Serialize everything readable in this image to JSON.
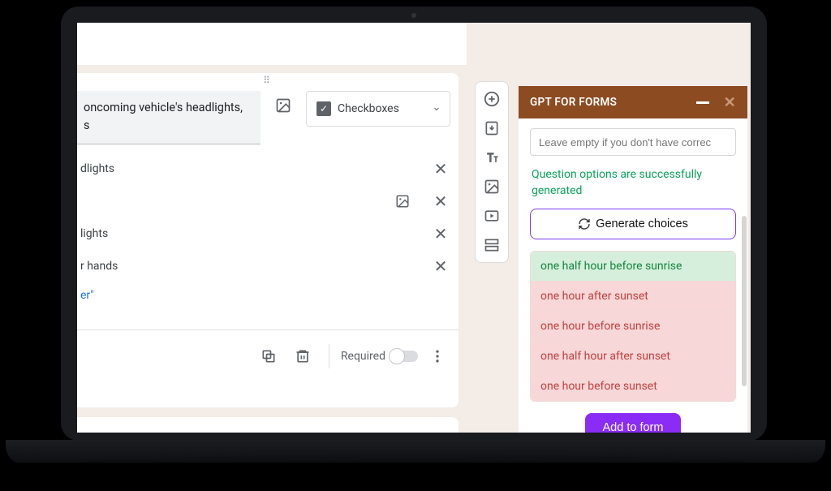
{
  "form": {
    "question_text": "oncoming vehicle's headlights,\ns",
    "image_icon": "image-icon",
    "type_label": "Checkboxes",
    "options": [
      {
        "label": "dlights"
      },
      {
        "label": ""
      },
      {
        "label": "lights"
      },
      {
        "label": "r hands"
      }
    ],
    "add_other": "er\"",
    "duplicate_label": "Duplicate",
    "delete_label": "Delete",
    "required_label": "Required"
  },
  "next_card_text": "",
  "rail": {
    "items": [
      "add-circle",
      "import",
      "text-title",
      "image",
      "video",
      "section"
    ]
  },
  "panel": {
    "title": "GPT FOR FORMS",
    "input_placeholder": "Leave empty if you don't have correc",
    "status": "Question options are successfully generated",
    "generate_label": "Generate choices",
    "choices": [
      {
        "text": "one half hour before sunrise",
        "state": "good"
      },
      {
        "text": "one hour after sunset",
        "state": "bad"
      },
      {
        "text": "one hour before sunrise",
        "state": "bad"
      },
      {
        "text": "one half hour after sunset",
        "state": "bad"
      },
      {
        "text": "one hour before sunset",
        "state": "bad"
      }
    ],
    "add_label": "Add to form"
  }
}
